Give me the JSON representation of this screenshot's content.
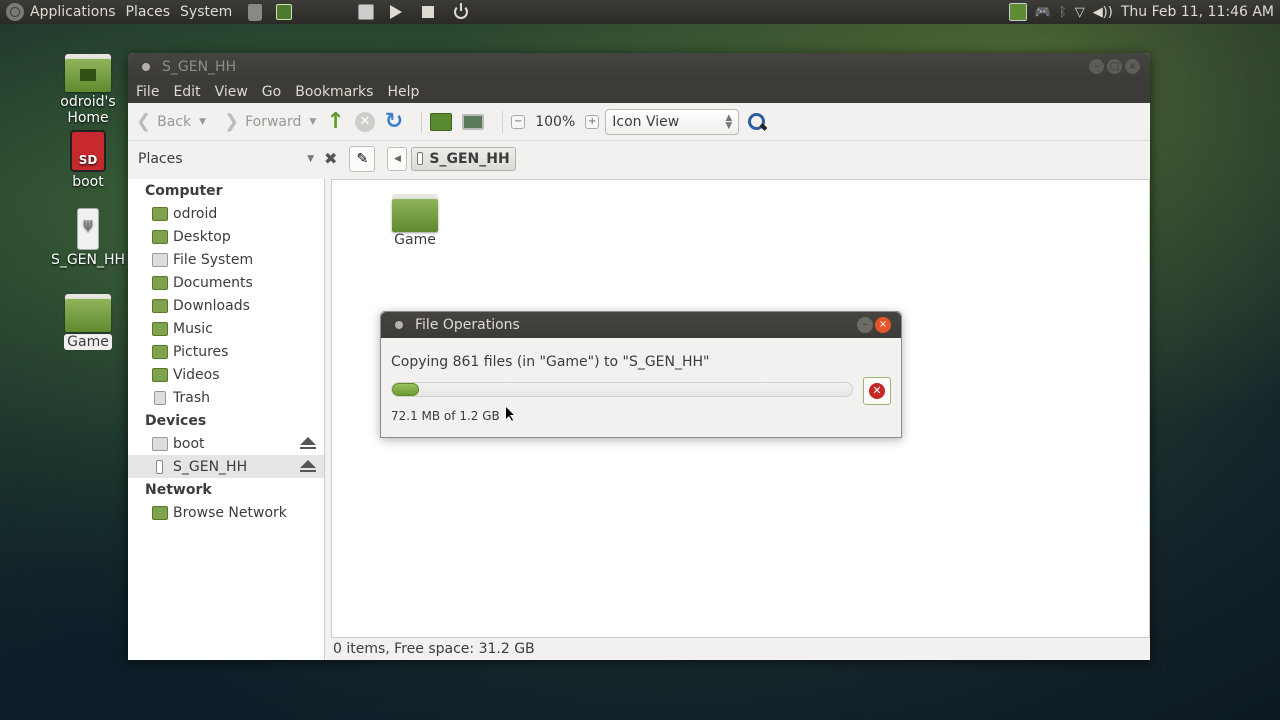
{
  "panel": {
    "menus": [
      "Applications",
      "Places",
      "System"
    ],
    "launchers": [
      "trash-icon",
      "show-desktop-icon",
      "file-manager-icon",
      "play-icon",
      "stop-icon",
      "power-icon"
    ],
    "tray": [
      "storage-indicator-icon",
      "game-controller-icon",
      "bluetooth-icon",
      "wifi-icon",
      "volume-icon"
    ],
    "clock": "Thu Feb 11, 11:46 AM"
  },
  "desktop": {
    "icons": [
      {
        "label": "odroid's Home",
        "icon": "home-folder-icon"
      },
      {
        "label": "boot",
        "icon": "sd-card-icon"
      },
      {
        "label": "S_GEN_HH",
        "icon": "usb-drive-icon"
      },
      {
        "label": "Game",
        "icon": "folder-icon"
      }
    ]
  },
  "window": {
    "title": "S_GEN_HH",
    "menu": [
      "File",
      "Edit",
      "View",
      "Go",
      "Bookmarks",
      "Help"
    ],
    "toolbar": {
      "back": "Back",
      "forward": "Forward",
      "zoom": "100%",
      "view_mode": "Icon View"
    },
    "sidebar": {
      "header": "Places",
      "sections": [
        {
          "title": "Computer",
          "items": [
            "odroid",
            "Desktop",
            "File System",
            "Documents",
            "Downloads",
            "Music",
            "Pictures",
            "Videos",
            "Trash"
          ]
        },
        {
          "title": "Devices",
          "items": [
            "boot",
            "S_GEN_HH"
          ]
        },
        {
          "title": "Network",
          "items": [
            "Browse Network"
          ]
        }
      ],
      "selected": "S_GEN_HH"
    },
    "breadcrumb": "S_GEN_HH",
    "content": {
      "items": [
        {
          "label": "Game",
          "icon": "folder-icon"
        }
      ]
    },
    "status": "0 items, Free space: 31.2 GB"
  },
  "dialog": {
    "title": "File Operations",
    "message": "Copying 861 files (in \"Game\") to \"S_GEN_HH\"",
    "progress_fraction": 0.058,
    "detail": "72.1 MB of 1.2 GB",
    "accent": "#6b9b33"
  }
}
